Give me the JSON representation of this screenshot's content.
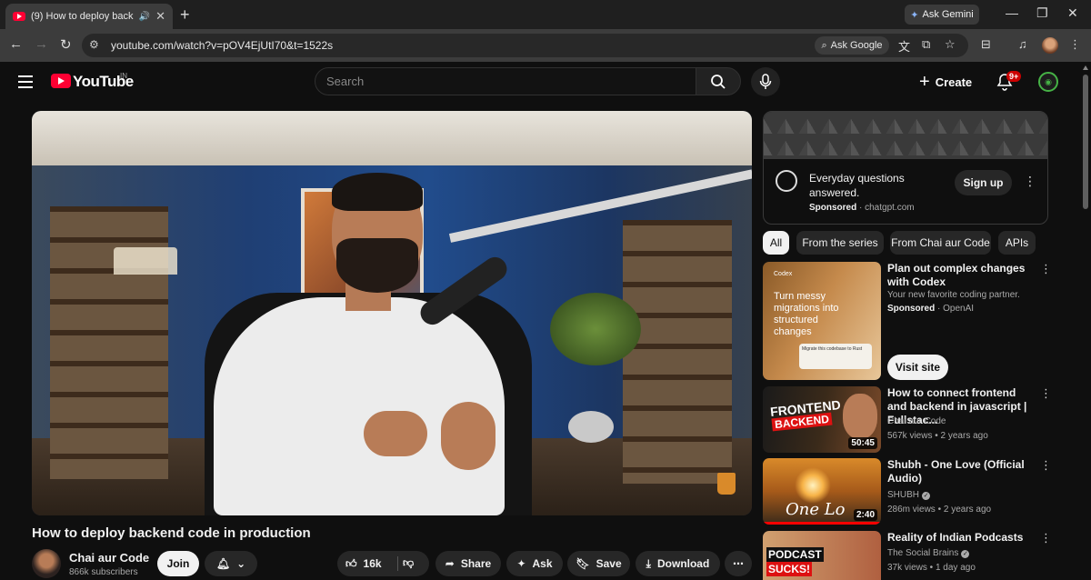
{
  "browser": {
    "tab_title": "(9) How to deploy backend",
    "new_tab": "+",
    "gemini_label": "Ask Gemini",
    "url": "youtube.com/watch?v=pOV4EjUtI70&t=1522s",
    "ask_google": "Ask Google",
    "window_controls": [
      "—",
      "❐",
      "✕"
    ]
  },
  "header": {
    "logo_text": "YouTube",
    "country": "IN",
    "search_placeholder": "Search",
    "create_label": "Create",
    "notifications_badge": "9+"
  },
  "video": {
    "title": "How to deploy backend code in production",
    "channel": "Chai aur Code",
    "subscribers": "866k subscribers",
    "join_label": "Join",
    "likes": "16k",
    "share_label": "Share",
    "ask_label": "Ask",
    "save_label": "Save",
    "download_label": "Download"
  },
  "sidebar": {
    "ad": {
      "title": "Everyday questions answered.",
      "sponsored": "Sponsored",
      "domain": "chatgpt.com",
      "cta": "Sign up"
    },
    "chips": [
      "All",
      "From the series",
      "From Chai aur Code",
      "APIs"
    ],
    "items": [
      {
        "title": "Plan out complex changes with Codex",
        "subtitle": "Your new favorite coding partner.",
        "sponsored": "Sponsored",
        "advertiser": "OpenAI",
        "cta": "Visit site",
        "thumb_label": "Codex",
        "thumb_text": "Turn messy migrations into structured changes",
        "thumb_box": "Migrate this codebase to Rust"
      },
      {
        "title": "How to connect frontend and backend in javascript | Fullstac...",
        "channel": "Chai aur Code",
        "meta": "567k views • 2 years ago",
        "duration": "50:45",
        "thumb_line1": "FRONTEND",
        "thumb_line2": "BACKEND",
        "progress": 0.0
      },
      {
        "title": "Shubh - One Love (Official Audio)",
        "channel": "SHUBH",
        "meta": "286m views • 2 years ago",
        "duration": "2:40",
        "thumb_text": "One Lo",
        "progress": 1.0
      },
      {
        "title": "Reality of Indian Podcasts",
        "channel": "The Social Brains",
        "meta": "37k views • 1 day ago",
        "thumb_line1": "PODCAST",
        "thumb_line2": "SUCKS!",
        "progress": 1.0
      }
    ]
  },
  "colors": {
    "background": "#0f0f0f",
    "accent": "#ff0033",
    "pill": "#272727"
  }
}
